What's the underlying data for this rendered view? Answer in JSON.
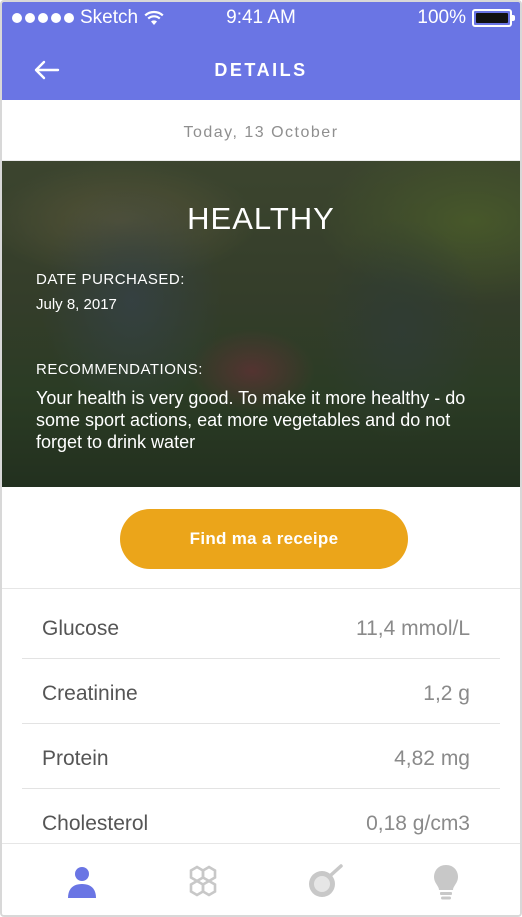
{
  "status_bar": {
    "carrier": "Sketch",
    "time": "9:41 AM",
    "battery": "100%"
  },
  "nav": {
    "title": "DETAILS"
  },
  "date": "Today, 13 October",
  "hero": {
    "title": "HEALTHY",
    "date_label": "DATE PURCHASED:",
    "date_value": "July 8, 2017",
    "rec_label": "RECOMMENDATIONS:",
    "rec_text": "Your health is very good. To make it more healthy - do some sport actions, eat more vegetables and do not forget to drink water"
  },
  "cta": {
    "label": "Find ma a receipe"
  },
  "metrics": [
    {
      "name": "Glucose",
      "value": "11,4 mmol/L"
    },
    {
      "name": "Creatinine",
      "value": "1,2 g"
    },
    {
      "name": "Protein",
      "value": "4,82 mg"
    },
    {
      "name": "Cholesterol",
      "value": "0,18 g/cm3"
    }
  ],
  "tabs": [
    "person-icon",
    "hexagon-icon",
    "pan-icon",
    "lightbulb-icon"
  ],
  "colors": {
    "accent": "#6a75e4",
    "cta": "#eba51a",
    "tab_inactive": "#c8c8c8"
  }
}
